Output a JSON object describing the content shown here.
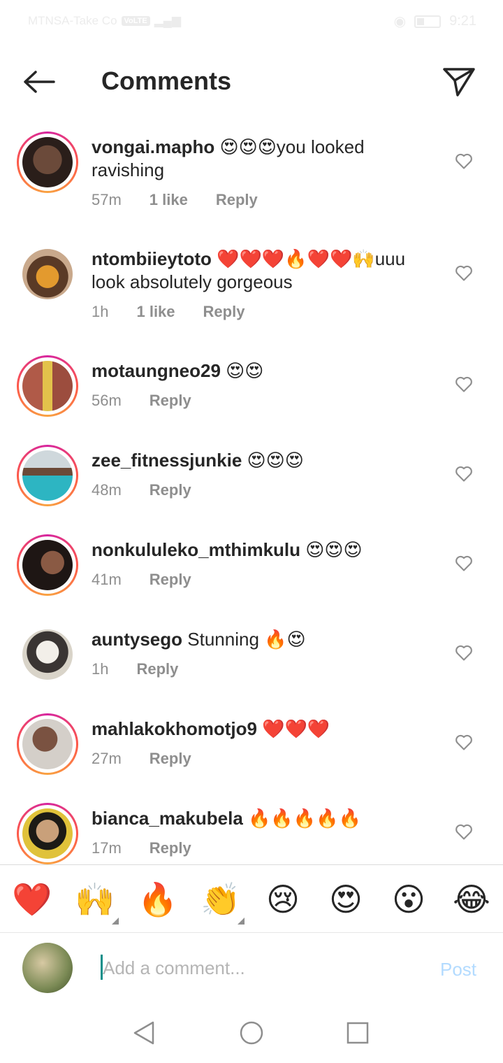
{
  "status_bar": {
    "carrier": "MTNSA-Take Co",
    "network_badge": "VoLTE",
    "time": "9:21"
  },
  "header": {
    "title": "Comments",
    "back_icon": "arrow-left-icon",
    "send_icon": "paper-plane-icon"
  },
  "comments": [
    {
      "username": "vongai.mapho",
      "text": "😍😍😍you looked ravishing",
      "time": "57m",
      "likes": "1 like",
      "reply": "Reply"
    },
    {
      "username": "ntombiieytoto",
      "text": "❤️❤️❤️🔥❤️❤️🙌uuu look absolutely gorgeous",
      "time": "1h",
      "likes": "1 like",
      "reply": "Reply"
    },
    {
      "username": "motaungneo29",
      "text": "😍😍",
      "time": "56m",
      "likes": "",
      "reply": "Reply"
    },
    {
      "username": "zee_fitnessjunkie",
      "text": "😍😍😍",
      "time": "48m",
      "likes": "",
      "reply": "Reply"
    },
    {
      "username": "nonkululeko_mthimkulu",
      "text": "😍😍😍",
      "time": "41m",
      "likes": "",
      "reply": "Reply"
    },
    {
      "username": "auntysego",
      "text": "Stunning 🔥😍",
      "time": "1h",
      "likes": "",
      "reply": "Reply"
    },
    {
      "username": "mahlakokhomotjo9",
      "text": "❤️❤️❤️",
      "time": "27m",
      "likes": "",
      "reply": "Reply"
    },
    {
      "username": "bianca_makubela",
      "text": "🔥🔥🔥🔥🔥",
      "time": "17m",
      "likes": "",
      "reply": "Reply"
    }
  ],
  "emoji_bar": {
    "items": [
      "❤️",
      "🙌",
      "🔥",
      "👏",
      "😢",
      "😍",
      "😮",
      "😂"
    ]
  },
  "comment_input": {
    "placeholder": "Add a comment...",
    "post_label": "Post"
  },
  "colors": {
    "text": "#262626",
    "secondary": "#8e8e8e",
    "post_disabled": "#b3dbff"
  }
}
